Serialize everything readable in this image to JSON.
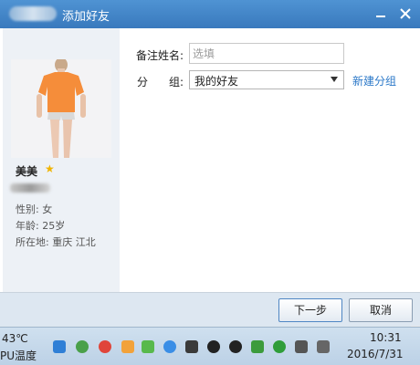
{
  "window": {
    "title": "添加好友",
    "minimize_glyph": "—",
    "close_glyph": "✕"
  },
  "profile": {
    "nickname": "美美",
    "star_icon": "star-icon",
    "gender": "性别: 女",
    "age": "年龄: 25岁",
    "location": "所在地: 重庆  江北"
  },
  "form": {
    "remark_label": "备注姓名:",
    "remark_placeholder": "选填",
    "group_label_1": "分",
    "group_label_2": "组:",
    "group_value": "我的好友",
    "new_group_link": "新建分组"
  },
  "footer": {
    "next_button": "下一步",
    "cancel_button": "取消"
  },
  "taskbar": {
    "temp_value": "43℃",
    "temp_label": "PU温度",
    "time": "10:31",
    "date": "2016/7/31"
  },
  "colors": {
    "title_bar": "#3f84c8",
    "link": "#2b78c8",
    "star": "#f0b400"
  }
}
